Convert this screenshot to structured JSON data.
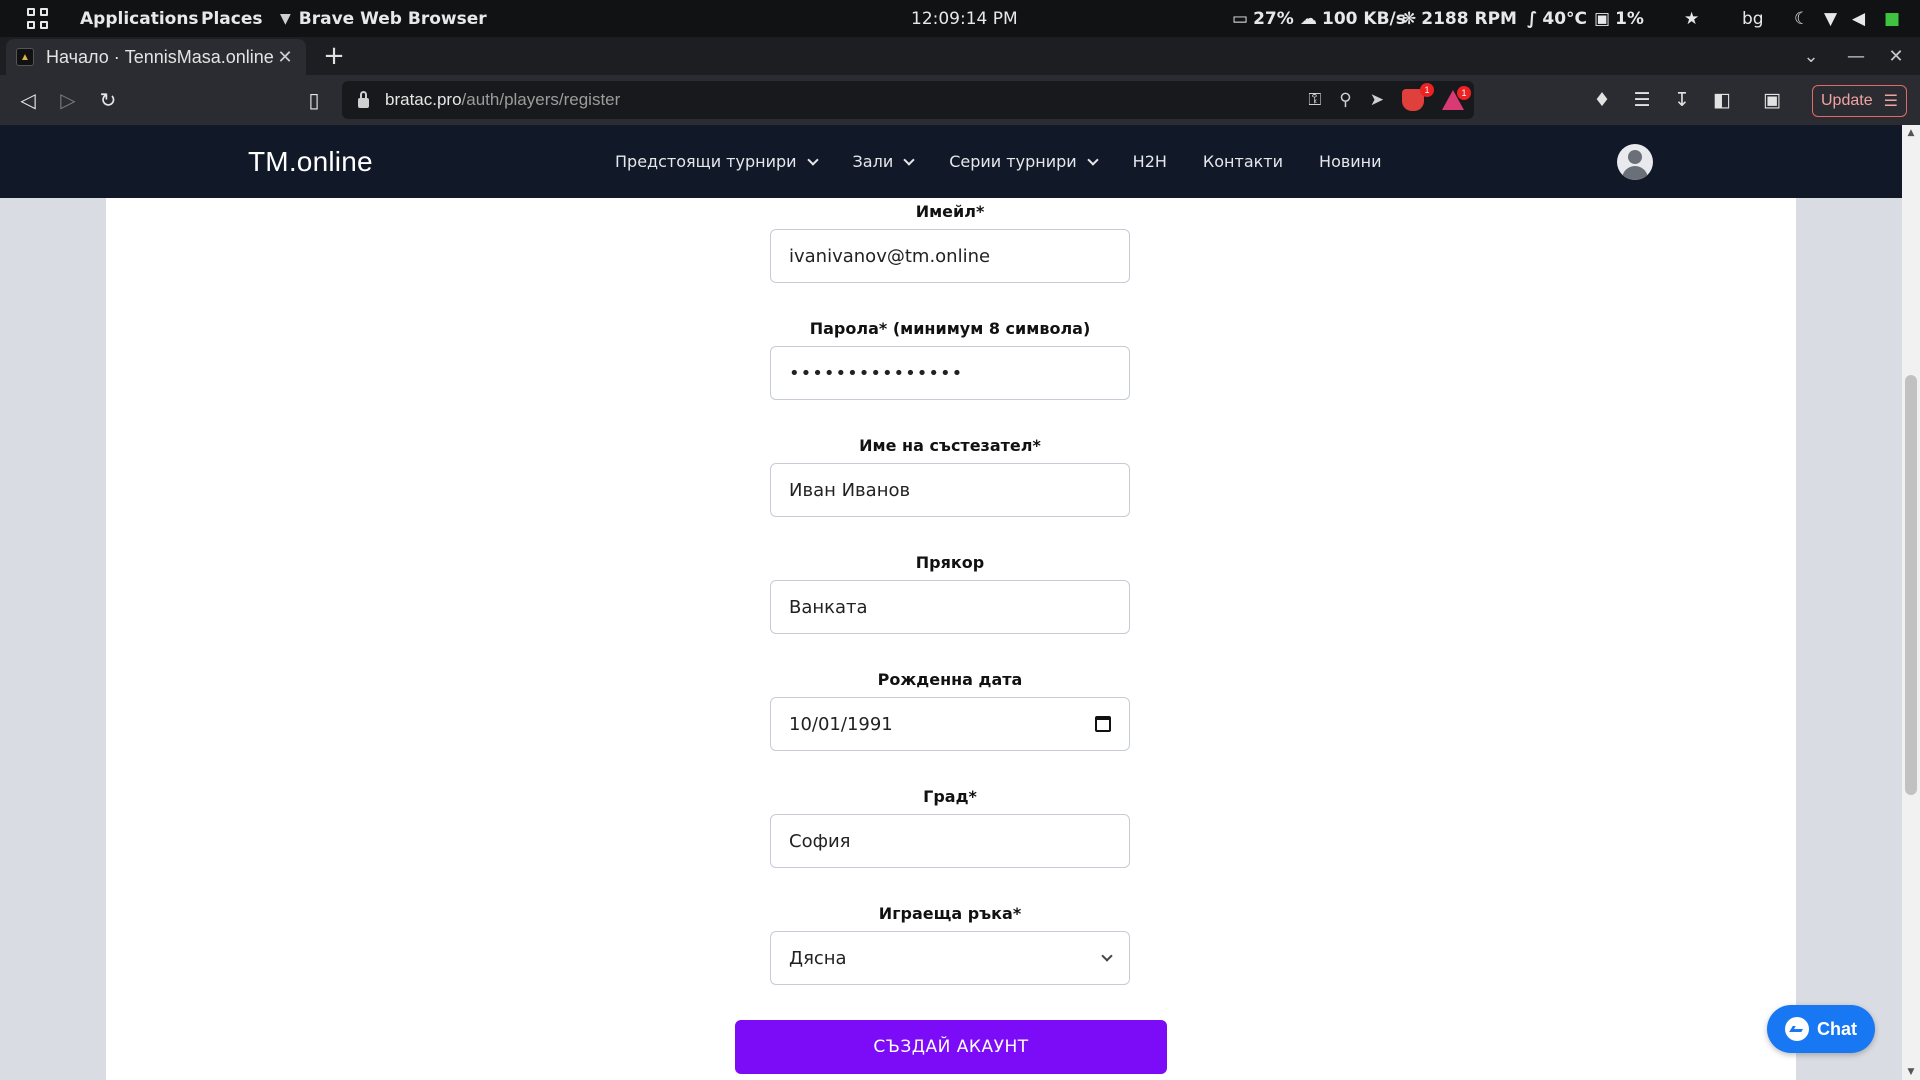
{
  "os_bar": {
    "applications": "Applications",
    "places": "Places",
    "active_app": "Brave Web Browser",
    "clock": "12:09:14 PM",
    "battery": "27%",
    "network": "100 KB/s",
    "fan": "2188 RPM",
    "temp": "40°C",
    "disk": "1%",
    "lang": "bg"
  },
  "browser": {
    "tab_title": "Начало · TennisMasa.online",
    "url_host": "bratac.pro",
    "url_path": "/auth/players/register",
    "brave_badge": "1",
    "rewards_badge": "1",
    "update_label": "Update"
  },
  "site": {
    "logo": "TM.online",
    "menu": [
      {
        "label": "Предстоящи турнири"
      },
      {
        "label": "Зали"
      },
      {
        "label": "Серии турнири"
      },
      {
        "label": "H2H"
      },
      {
        "label": "Контакти"
      },
      {
        "label": "Новини"
      }
    ]
  },
  "form": {
    "email": {
      "label": "Имейл*",
      "value": "ivanivanov@tm.online"
    },
    "password": {
      "label": "Парола* (минимум 8 символа)",
      "value": "•••••••••••••••"
    },
    "name": {
      "label": "Име на състезател*",
      "value": "Иван Иванов"
    },
    "nickname": {
      "label": "Прякор",
      "value": "Ванката"
    },
    "birthdate": {
      "label": "Рожденна дата",
      "value": "10/01/1991"
    },
    "city": {
      "label": "Град*",
      "value": "София"
    },
    "hand": {
      "label": "Играеща ръка*",
      "value": "Дясна"
    },
    "submit_label": "СЪЗДАЙ АКАУНТ"
  },
  "chat": {
    "label": "Chat"
  }
}
